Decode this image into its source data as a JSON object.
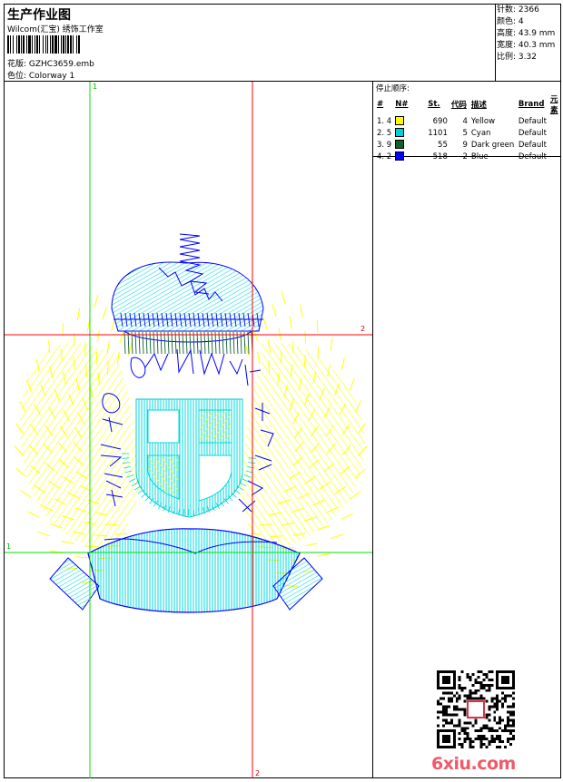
{
  "header": {
    "title": "生产作业图",
    "subtitle": "Wilcom(汇宝) 绣饰工作室",
    "design_label": "花版: GZHC3659.emb",
    "colorway_label": "色位: Colorway 1"
  },
  "stats": {
    "stitches": "针数: 2366",
    "colors": "颜色: 4",
    "height": "高度: 43.9 mm",
    "width": "宽度: 40.3 mm",
    "scale": "比例: 3.32"
  },
  "sequence": {
    "title": "停止顺序:",
    "headers": [
      "#",
      "N#",
      "St.",
      "代码",
      "描述",
      "Brand",
      "元素"
    ],
    "rows": [
      {
        "idx": "1. 4",
        "color": "#ffff00",
        "st": "690",
        "code": "4",
        "desc": "Yellow",
        "brand": "Default"
      },
      {
        "idx": "2. 5",
        "color": "#00d0d8",
        "st": "1101",
        "code": "5",
        "desc": "Cyan",
        "brand": "Default"
      },
      {
        "idx": "3. 9",
        "color": "#106030",
        "st": "55",
        "code": "9",
        "desc": "Dark green",
        "brand": "Default"
      },
      {
        "idx": "4. 2",
        "color": "#0000ff",
        "st": "518",
        "code": "2",
        "desc": "Blue",
        "brand": "Default"
      }
    ]
  },
  "guides": {
    "v1_label": "1",
    "v2_label": "2",
    "h1_label": "1",
    "h2_label": "2"
  },
  "watermark": "6xiu.com",
  "colors": {
    "yellow": "#ffff00",
    "cyan": "#00d0d8",
    "dark_green": "#106030",
    "blue": "#0000ff",
    "guide_green": "#00e000",
    "guide_red": "#ff0000"
  }
}
